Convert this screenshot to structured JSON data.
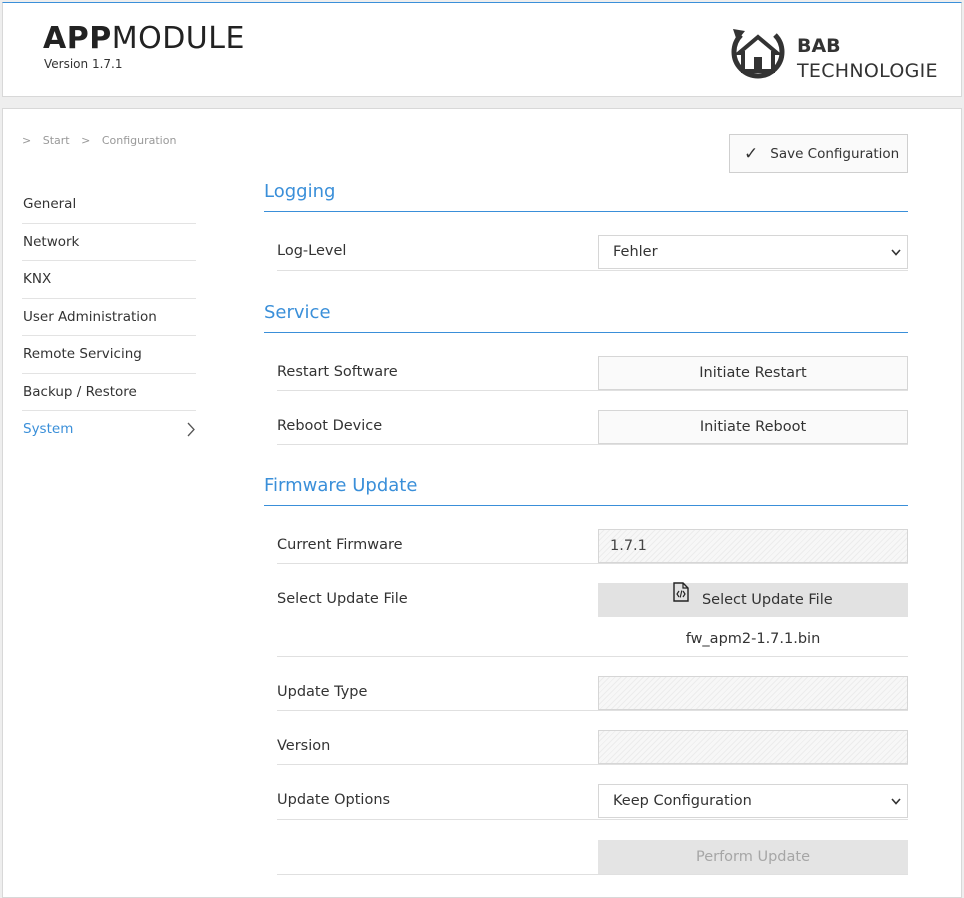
{
  "header": {
    "title_bold": "APP",
    "title_light": "MODULE",
    "version": "Version 1.7.1",
    "logo_line1": "BAB",
    "logo_line2": "TECHNOLOGIE"
  },
  "breadcrumb": {
    "sep": ">",
    "items": [
      "Start",
      "Configuration"
    ]
  },
  "sidebar": {
    "items": [
      {
        "label": "General"
      },
      {
        "label": "Network"
      },
      {
        "label": "KNX"
      },
      {
        "label": "User Administration"
      },
      {
        "label": "Remote Servicing"
      },
      {
        "label": "Backup / Restore"
      },
      {
        "label": "System"
      }
    ],
    "active": "System",
    "chevron": ">"
  },
  "toolbar": {
    "save_icon": "✓",
    "save_label": "Save Configuration"
  },
  "logging": {
    "title": "Logging",
    "log_level_label": "Log-Level",
    "log_level_value": "Fehler"
  },
  "service": {
    "title": "Service",
    "restart_label": "Restart Software",
    "restart_button": "Initiate Restart",
    "reboot_label": "Reboot Device",
    "reboot_button": "Initiate Reboot"
  },
  "firmware": {
    "title": "Firmware Update",
    "current_label": "Current Firmware",
    "current_value": "1.7.1",
    "select_label": "Select Update File",
    "select_button": "Select Update File",
    "file_name": "fw_apm2-1.7.1.bin",
    "type_label": "Update Type",
    "type_value": "",
    "version_label": "Version",
    "version_value": "",
    "options_label": "Update Options",
    "options_value": "Keep Configuration",
    "perform_button": "Perform Update"
  },
  "icons": {
    "caret": "chevron-down-icon",
    "check": "check-icon",
    "file": "file-code-icon",
    "logo": "house-refresh-icon"
  },
  "colors": {
    "accent": "#3a8fd9",
    "text": "#333333",
    "border": "#e0e0e0"
  }
}
